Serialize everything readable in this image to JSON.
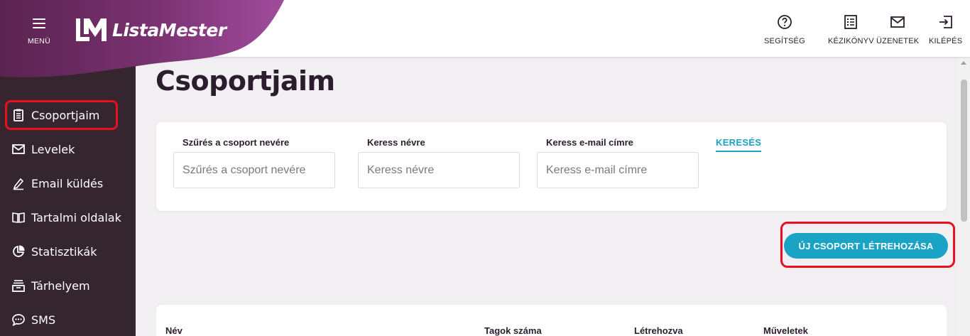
{
  "brand": {
    "name": "ListaMester",
    "menu_label": "MENÜ"
  },
  "colors": {
    "sidebar": "#35252f",
    "accent": "#1aa3c4",
    "highlight": "#e8101f",
    "brand_gradient_start": "#5a2350",
    "brand_gradient_end": "#9b4a97"
  },
  "sidebar": {
    "items": [
      {
        "label": "Csoportjaim",
        "icon": "clipboard-list-icon",
        "active": true
      },
      {
        "label": "Levelek",
        "icon": "envelope-icon"
      },
      {
        "label": "Email küldés",
        "icon": "pencil-icon"
      },
      {
        "label": "Tartalmi oldalak",
        "icon": "book-open-icon"
      },
      {
        "label": "Statisztikák",
        "icon": "pie-chart-icon"
      },
      {
        "label": "Tárhelyem",
        "icon": "storage-icon"
      },
      {
        "label": "SMS",
        "icon": "chat-bubble-icon"
      }
    ]
  },
  "header": {
    "buttons": [
      {
        "label": "SEGÍTSÉG",
        "icon": "help-circle-icon"
      },
      {
        "label": "KÉZIKÖNYV",
        "icon": "manual-icon"
      },
      {
        "label": "ÜZENETEK",
        "icon": "mail-icon"
      },
      {
        "label": "KILÉPÉS",
        "icon": "logout-icon"
      }
    ]
  },
  "main": {
    "title": "Csoportjaim",
    "filters": {
      "group_name": {
        "label": "Szűrés a csoport nevére",
        "placeholder": "Szűrés a csoport nevére",
        "value": ""
      },
      "name": {
        "label": "Keress névre",
        "placeholder": "Keress névre",
        "value": ""
      },
      "email": {
        "label": "Keress e-mail címre",
        "placeholder": "Keress e-mail címre",
        "value": ""
      },
      "search_label": "KERESÉS"
    },
    "new_group_label": "ÚJ CSOPORT LÉTREHOZÁSA",
    "table": {
      "columns": [
        "Név",
        "Tagok száma",
        "Létrehozva",
        "Műveletek"
      ]
    }
  }
}
